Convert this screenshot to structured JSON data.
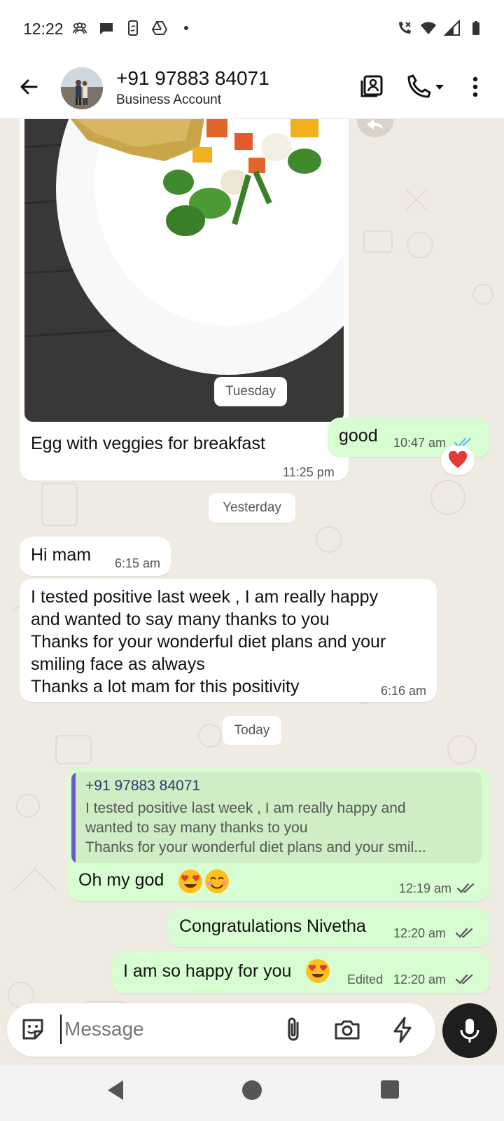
{
  "status_bar": {
    "time": "12:22"
  },
  "header": {
    "contact_name": "+91 97883 84071",
    "contact_subtitle": "Business Account"
  },
  "messages": {
    "photo_caption": "Egg with veggies for breakfast",
    "photo_time": "11:25 pm",
    "date_tuesday": "Tuesday",
    "good_text": "good",
    "good_time": "10:47 am",
    "reaction": "❤️",
    "date_yesterday": "Yesterday",
    "hi_text": "Hi mam",
    "hi_time": "6:15 am",
    "long_lines": [
      "I tested positive last week , I am really happy",
      "and wanted to say many thanks to you",
      "Thanks for your wonderful diet plans and your",
      "smiling face as always",
      "Thanks a lot mam for this positivity"
    ],
    "long_time": "6:16 am",
    "date_today": "Today",
    "quote_author": "+91 97883 84071",
    "quote_lines": [
      "I tested positive last week , I am really happy and",
      "wanted to say many thanks to you",
      "Thanks for your wonderful diet plans and your smil..."
    ],
    "reply_text": "Oh my god",
    "reply_time": "12:19 am",
    "congrats_text": "Congratulations Nivetha",
    "congrats_time": "12:20 am",
    "happy_text": "I am so happy for you",
    "happy_edited": "Edited",
    "happy_time": "12:20 am"
  },
  "input": {
    "placeholder": "Message"
  },
  "colors": {
    "outgoing_bubble": "#d9fdd3",
    "incoming_bubble": "#ffffff",
    "chat_background": "#efeae2",
    "read_tick": "#53bdeb",
    "quote_bar": "#6a5acd"
  }
}
